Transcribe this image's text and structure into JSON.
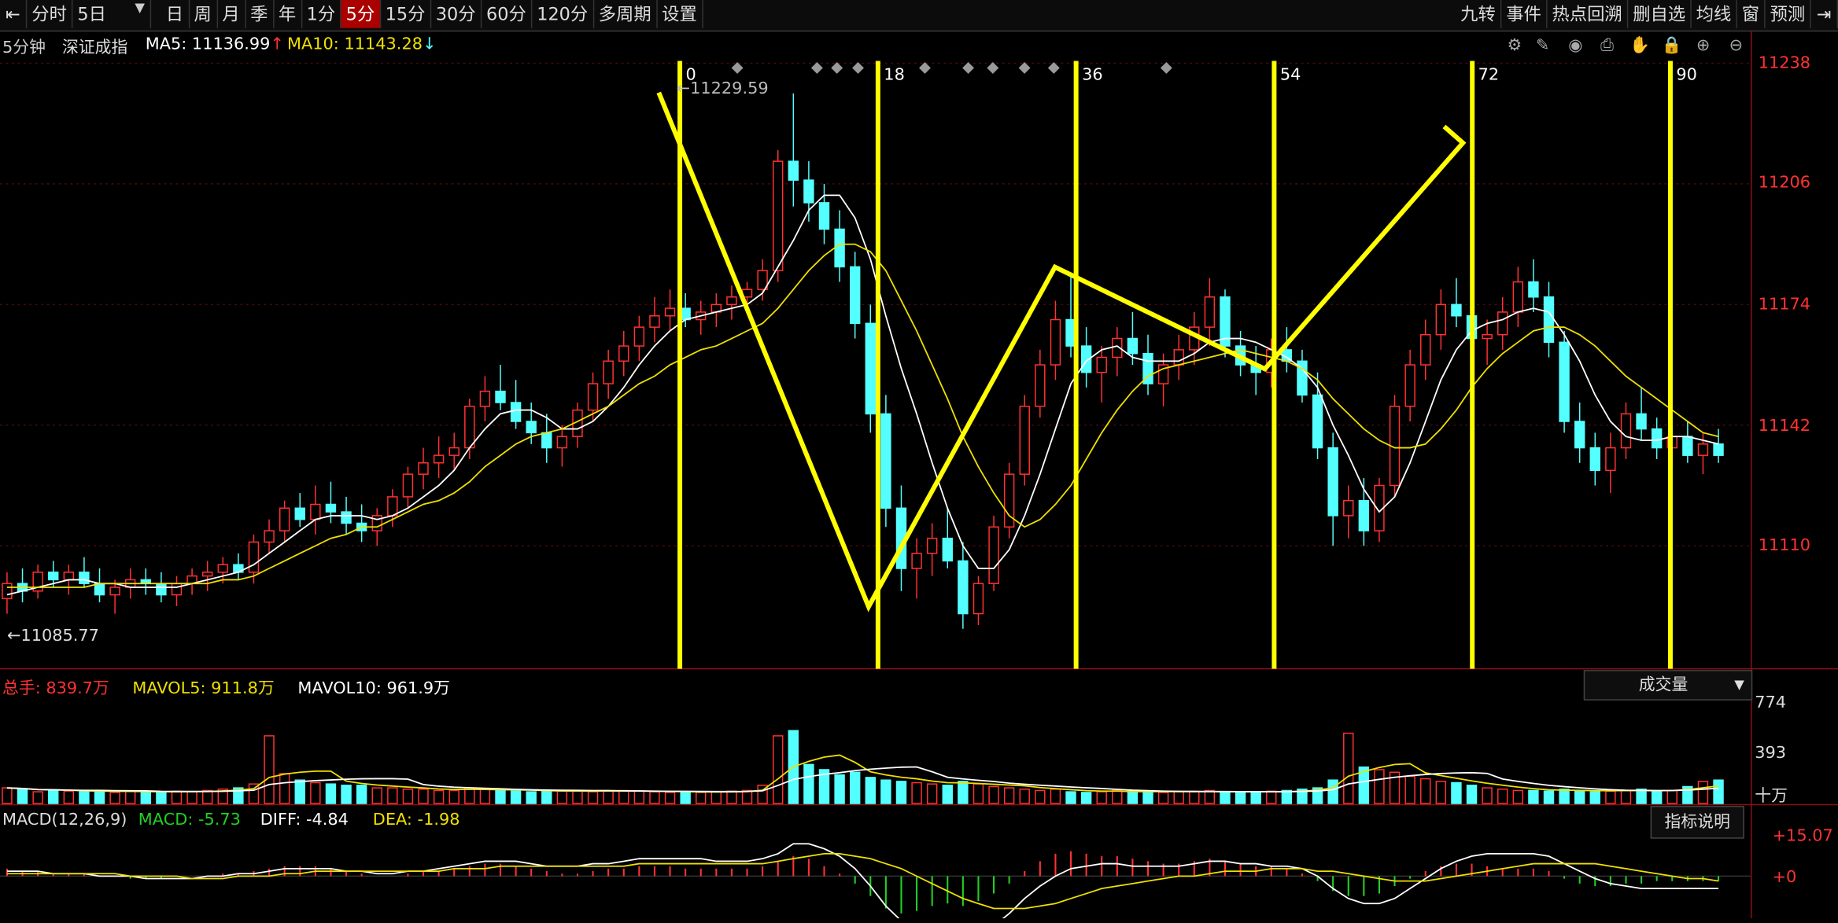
{
  "toolbar": {
    "periods": [
      "分时",
      "5日",
      "日",
      "周",
      "月",
      "季",
      "年",
      "1分",
      "5分",
      "15分",
      "30分",
      "60分",
      "120分",
      "多周期",
      "设置"
    ],
    "active_period": "5分",
    "right": [
      "九转",
      "事件",
      "热点回溯",
      "删自选",
      "均线",
      "窗",
      "预测"
    ]
  },
  "header": {
    "period": "5分钟",
    "name": "深证成指",
    "ma5": "MA5: 11136.99",
    "ma5_arrow": "↑",
    "ma10": "MA10: 11143.28",
    "ma10_arrow": "↓"
  },
  "markers": {
    "high": "11229.59",
    "low": "11085.77",
    "counts": [
      "0",
      "18",
      "36",
      "54",
      "72",
      "90"
    ]
  },
  "price_axis": [
    "11238",
    "11206",
    "11174",
    "11142",
    "11110"
  ],
  "volume": {
    "total": "总手: 839.7万",
    "mavol5": "MAVOL5: 911.8万",
    "mavol10": "MAVOL10: 961.9万",
    "selector": "成交量",
    "axis": [
      "774",
      "393",
      "十万"
    ]
  },
  "macd": {
    "title": "MACD(12,26,9)",
    "macd": "MACD: -5.73",
    "diff": "DIFF: -4.84",
    "dea": "DEA: -1.98",
    "explain": "指标说明",
    "axis": [
      "+15.07",
      "+0"
    ]
  },
  "colors": {
    "up": "#ff3232",
    "down": "#54ffff",
    "ma5": "#ffffff",
    "ma10": "#f0e000",
    "annotation": "#ffff00"
  },
  "chart_data": {
    "type": "candlestick",
    "title": "深证成指 5分钟",
    "ylim": [
      11080,
      11240
    ],
    "candles": [
      [
        11096,
        11103,
        11092,
        11100
      ],
      [
        11100,
        11104,
        11095,
        11098
      ],
      [
        11098,
        11105,
        11096,
        11103
      ],
      [
        11103,
        11106,
        11099,
        11101
      ],
      [
        11101,
        11105,
        11097,
        11103
      ],
      [
        11103,
        11107,
        11099,
        11100
      ],
      [
        11100,
        11104,
        11095,
        11097
      ],
      [
        11097,
        11101,
        11092,
        11099
      ],
      [
        11099,
        11104,
        11096,
        11101
      ],
      [
        11101,
        11104,
        11097,
        11100
      ],
      [
        11100,
        11103,
        11095,
        11097
      ],
      [
        11097,
        11102,
        11094,
        11100
      ],
      [
        11100,
        11104,
        11097,
        11102
      ],
      [
        11102,
        11106,
        11098,
        11103
      ],
      [
        11103,
        11107,
        11100,
        11105
      ],
      [
        11105,
        11108,
        11101,
        11103
      ],
      [
        11103,
        11113,
        11100,
        11111
      ],
      [
        11111,
        11117,
        11108,
        11114
      ],
      [
        11114,
        11122,
        11111,
        11120
      ],
      [
        11120,
        11124,
        11115,
        11117
      ],
      [
        11117,
        11126,
        11113,
        11121
      ],
      [
        11121,
        11127,
        11116,
        11119
      ],
      [
        11119,
        11123,
        11113,
        11116
      ],
      [
        11116,
        11121,
        11111,
        11114
      ],
      [
        11114,
        11120,
        11110,
        11118
      ],
      [
        11118,
        11125,
        11115,
        11123
      ],
      [
        11123,
        11131,
        11120,
        11129
      ],
      [
        11129,
        11136,
        11125,
        11132
      ],
      [
        11132,
        11139,
        11128,
        11134
      ],
      [
        11134,
        11140,
        11130,
        11136
      ],
      [
        11136,
        11149,
        11133,
        11147
      ],
      [
        11147,
        11155,
        11143,
        11151
      ],
      [
        11151,
        11158,
        11146,
        11148
      ],
      [
        11148,
        11154,
        11141,
        11143
      ],
      [
        11143,
        11148,
        11137,
        11140
      ],
      [
        11140,
        11145,
        11132,
        11136
      ],
      [
        11136,
        11142,
        11131,
        11139
      ],
      [
        11139,
        11148,
        11136,
        11146
      ],
      [
        11146,
        11156,
        11143,
        11153
      ],
      [
        11153,
        11162,
        11149,
        11159
      ],
      [
        11159,
        11167,
        11155,
        11163
      ],
      [
        11163,
        11171,
        11159,
        11168
      ],
      [
        11168,
        11176,
        11164,
        11171
      ],
      [
        11171,
        11178,
        11167,
        11173
      ],
      [
        11173,
        11177,
        11168,
        11170
      ],
      [
        11170,
        11175,
        11166,
        11172
      ],
      [
        11172,
        11177,
        11168,
        11174
      ],
      [
        11174,
        11179,
        11170,
        11176
      ],
      [
        11176,
        11180,
        11172,
        11178
      ],
      [
        11178,
        11186,
        11175,
        11183
      ],
      [
        11183,
        11215,
        11180,
        11212
      ],
      [
        11212,
        11230,
        11200,
        11207
      ],
      [
        11207,
        11212,
        11196,
        11201
      ],
      [
        11201,
        11206,
        11190,
        11194
      ],
      [
        11194,
        11199,
        11180,
        11184
      ],
      [
        11184,
        11188,
        11165,
        11169
      ],
      [
        11169,
        11174,
        11140,
        11145
      ],
      [
        11145,
        11150,
        11115,
        11120
      ],
      [
        11120,
        11126,
        11098,
        11104
      ],
      [
        11104,
        11112,
        11096,
        11108
      ],
      [
        11108,
        11116,
        11102,
        11112
      ],
      [
        11112,
        11120,
        11104,
        11106
      ],
      [
        11106,
        11111,
        11088,
        11092
      ],
      [
        11092,
        11102,
        11089,
        11100
      ],
      [
        11100,
        11118,
        11098,
        11115
      ],
      [
        11115,
        11132,
        11112,
        11129
      ],
      [
        11129,
        11150,
        11126,
        11147
      ],
      [
        11147,
        11162,
        11144,
        11158
      ],
      [
        11158,
        11175,
        11154,
        11170
      ],
      [
        11170,
        11182,
        11160,
        11163
      ],
      [
        11163,
        11168,
        11152,
        11156
      ],
      [
        11156,
        11163,
        11148,
        11160
      ],
      [
        11160,
        11168,
        11155,
        11165
      ],
      [
        11165,
        11172,
        11158,
        11161
      ],
      [
        11161,
        11166,
        11150,
        11153
      ],
      [
        11153,
        11161,
        11147,
        11158
      ],
      [
        11158,
        11166,
        11154,
        11162
      ],
      [
        11162,
        11172,
        11158,
        11168
      ],
      [
        11168,
        11181,
        11163,
        11176
      ],
      [
        11176,
        11178,
        11160,
        11163
      ],
      [
        11163,
        11167,
        11155,
        11158
      ],
      [
        11158,
        11163,
        11150,
        11156
      ],
      [
        11156,
        11165,
        11152,
        11162
      ],
      [
        11162,
        11168,
        11156,
        11159
      ],
      [
        11159,
        11162,
        11148,
        11150
      ],
      [
        11150,
        11156,
        11133,
        11136
      ],
      [
        11136,
        11140,
        11110,
        11118
      ],
      [
        11118,
        11126,
        11112,
        11122
      ],
      [
        11122,
        11128,
        11110,
        11114
      ],
      [
        11114,
        11128,
        11111,
        11126
      ],
      [
        11126,
        11150,
        11123,
        11147
      ],
      [
        11147,
        11162,
        11143,
        11158
      ],
      [
        11158,
        11170,
        11154,
        11166
      ],
      [
        11166,
        11178,
        11162,
        11174
      ],
      [
        11174,
        11181,
        11168,
        11171
      ],
      [
        11171,
        11176,
        11163,
        11165
      ],
      [
        11165,
        11170,
        11158,
        11166
      ],
      [
        11166,
        11176,
        11162,
        11172
      ],
      [
        11172,
        11184,
        11168,
        11180
      ],
      [
        11180,
        11186,
        11172,
        11176
      ],
      [
        11176,
        11180,
        11160,
        11164
      ],
      [
        11164,
        11167,
        11140,
        11143
      ],
      [
        11143,
        11148,
        11132,
        11136
      ],
      [
        11136,
        11140,
        11126,
        11130
      ],
      [
        11130,
        11140,
        11124,
        11136
      ],
      [
        11136,
        11148,
        11133,
        11145
      ],
      [
        11145,
        11152,
        11138,
        11141
      ],
      [
        11141,
        11144,
        11133,
        11136
      ],
      [
        11136,
        11142,
        11131,
        11139
      ],
      [
        11139,
        11143,
        11132,
        11134
      ],
      [
        11134,
        11140,
        11129,
        11137
      ],
      [
        11137,
        11141,
        11132,
        11134
      ]
    ],
    "ma5": [
      11097,
      11098,
      11099,
      11100,
      11101,
      11101,
      11100,
      11100,
      11099,
      11099,
      11099,
      11099,
      11100,
      11101,
      11102,
      11103,
      11105,
      11108,
      11111,
      11114,
      11117,
      11118,
      11118,
      11118,
      11117,
      11118,
      11120,
      11123,
      11126,
      11130,
      11136,
      11141,
      11145,
      11146,
      11146,
      11144,
      11141,
      11141,
      11143,
      11147,
      11152,
      11158,
      11163,
      11167,
      11170,
      11171,
      11172,
      11173,
      11174,
      11177,
      11184,
      11191,
      11199,
      11203,
      11203,
      11197,
      11186,
      11171,
      11157,
      11145,
      11132,
      11120,
      11110,
      11104,
      11104,
      11109,
      11118,
      11129,
      11141,
      11153,
      11159,
      11162,
      11163,
      11160,
      11159,
      11159,
      11159,
      11161,
      11164,
      11165,
      11165,
      11164,
      11162,
      11160,
      11157,
      11152,
      11142,
      11134,
      11125,
      11119,
      11123,
      11132,
      11143,
      11154,
      11162,
      11167,
      11169,
      11170,
      11172,
      11173,
      11172,
      11166,
      11159,
      11150,
      11143,
      11139,
      11138,
      11138,
      11139,
      11139,
      11138,
      11137
    ],
    "ma10": [
      11099,
      11099,
      11099,
      11099,
      11099,
      11099,
      11100,
      11100,
      11100,
      11100,
      11100,
      11100,
      11100,
      11100,
      11101,
      11101,
      11102,
      11104,
      11106,
      11108,
      11110,
      11112,
      11113,
      11115,
      11115,
      11117,
      11119,
      11121,
      11122,
      11124,
      11127,
      11131,
      11134,
      11137,
      11139,
      11140,
      11141,
      11143,
      11145,
      11147,
      11150,
      11153,
      11155,
      11158,
      11160,
      11162,
      11163,
      11165,
      11167,
      11169,
      11173,
      11178,
      11183,
      11187,
      11190,
      11190,
      11188,
      11183,
      11175,
      11167,
      11158,
      11149,
      11139,
      11131,
      11124,
      11118,
      11115,
      11117,
      11121,
      11126,
      11133,
      11140,
      11146,
      11151,
      11155,
      11157,
      11158,
      11159,
      11160,
      11161,
      11162,
      11161,
      11160,
      11159,
      11157,
      11154,
      11149,
      11145,
      11141,
      11138,
      11136,
      11136,
      11137,
      11141,
      11146,
      11152,
      11157,
      11161,
      11164,
      11167,
      11168,
      11168,
      11166,
      11163,
      11159,
      11155,
      11152,
      11149,
      11146,
      11143,
      11140,
      11139
    ],
    "volume": [
      120,
      110,
      90,
      100,
      95,
      90,
      100,
      85,
      95,
      90,
      85,
      95,
      90,
      100,
      110,
      120,
      150,
      520,
      230,
      180,
      160,
      150,
      140,
      140,
      120,
      120,
      110,
      110,
      100,
      100,
      120,
      110,
      100,
      95,
      90,
      100,
      95,
      100,
      90,
      95,
      100,
      95,
      90,
      85,
      90,
      85,
      90,
      95,
      100,
      140,
      520,
      560,
      300,
      260,
      220,
      240,
      200,
      180,
      170,
      160,
      150,
      140,
      170,
      150,
      130,
      120,
      110,
      100,
      110,
      90,
      85,
      90,
      100,
      95,
      90,
      85,
      90,
      95,
      100,
      85,
      80,
      90,
      95,
      100,
      110,
      120,
      180,
      540,
      280,
      260,
      240,
      210,
      190,
      170,
      160,
      140,
      120,
      110,
      100,
      100,
      95,
      110,
      100,
      90,
      95,
      100,
      110,
      95,
      100,
      130,
      170,
      180
    ],
    "macd_hist": [
      3,
      2,
      2,
      1,
      1,
      1,
      0,
      0,
      -1,
      -1,
      -1,
      0,
      0,
      0,
      1,
      1,
      2,
      3,
      4,
      4,
      4,
      3,
      2,
      1,
      0,
      0,
      1,
      2,
      2,
      3,
      4,
      5,
      5,
      4,
      3,
      2,
      1,
      1,
      2,
      3,
      3,
      4,
      4,
      4,
      3,
      3,
      3,
      3,
      3,
      4,
      6,
      8,
      7,
      4,
      1,
      -3,
      -8,
      -13,
      -15,
      -14,
      -12,
      -11,
      -12,
      -10,
      -7,
      -3,
      2,
      6,
      9,
      10,
      9,
      8,
      8,
      7,
      6,
      5,
      5,
      6,
      7,
      6,
      5,
      4,
      4,
      3,
      1,
      -2,
      -6,
      -8,
      -8,
      -7,
      -4,
      -1,
      2,
      4,
      5,
      5,
      4,
      3,
      3,
      3,
      2,
      -1,
      -3,
      -4,
      -4,
      -3,
      -3,
      -2,
      -2,
      -2,
      -2,
      -2
    ],
    "diff": [
      2,
      2,
      2,
      1,
      1,
      1,
      0,
      0,
      0,
      -1,
      -1,
      -1,
      -1,
      0,
      0,
      1,
      1,
      2,
      3,
      3,
      3,
      3,
      2,
      2,
      1,
      1,
      2,
      2,
      3,
      4,
      5,
      6,
      6,
      6,
      5,
      4,
      4,
      4,
      5,
      5,
      6,
      7,
      7,
      7,
      7,
      7,
      6,
      6,
      6,
      7,
      9,
      13,
      13,
      11,
      8,
      3,
      -4,
      -12,
      -18,
      -22,
      -24,
      -25,
      -26,
      -24,
      -20,
      -15,
      -9,
      -4,
      0,
      3,
      4,
      5,
      5,
      4,
      4,
      4,
      4,
      5,
      6,
      6,
      5,
      5,
      4,
      4,
      3,
      0,
      -5,
      -9,
      -11,
      -11,
      -9,
      -5,
      -1,
      3,
      6,
      8,
      9,
      9,
      9,
      9,
      8,
      5,
      2,
      -1,
      -3,
      -4,
      -5,
      -5,
      -5,
      -5,
      -5,
      -5
    ],
    "dea": [
      1,
      1,
      1,
      1,
      1,
      1,
      1,
      1,
      0,
      0,
      0,
      0,
      -1,
      -1,
      -1,
      0,
      0,
      0,
      1,
      1,
      2,
      2,
      2,
      2,
      2,
      2,
      2,
      2,
      2,
      3,
      3,
      3,
      4,
      4,
      4,
      4,
      4,
      4,
      4,
      4,
      4,
      5,
      5,
      5,
      5,
      5,
      5,
      5,
      5,
      5,
      6,
      7,
      8,
      9,
      9,
      8,
      7,
      5,
      3,
      0,
      -3,
      -6,
      -9,
      -11,
      -13,
      -13,
      -13,
      -12,
      -11,
      -9,
      -7,
      -5,
      -4,
      -3,
      -2,
      -1,
      0,
      0,
      1,
      2,
      2,
      2,
      3,
      3,
      3,
      2,
      2,
      1,
      0,
      -1,
      -2,
      -2,
      -2,
      -1,
      0,
      1,
      2,
      3,
      4,
      5,
      5,
      5,
      5,
      5,
      4,
      3,
      2,
      1,
      0,
      -1,
      -1,
      -2
    ]
  }
}
